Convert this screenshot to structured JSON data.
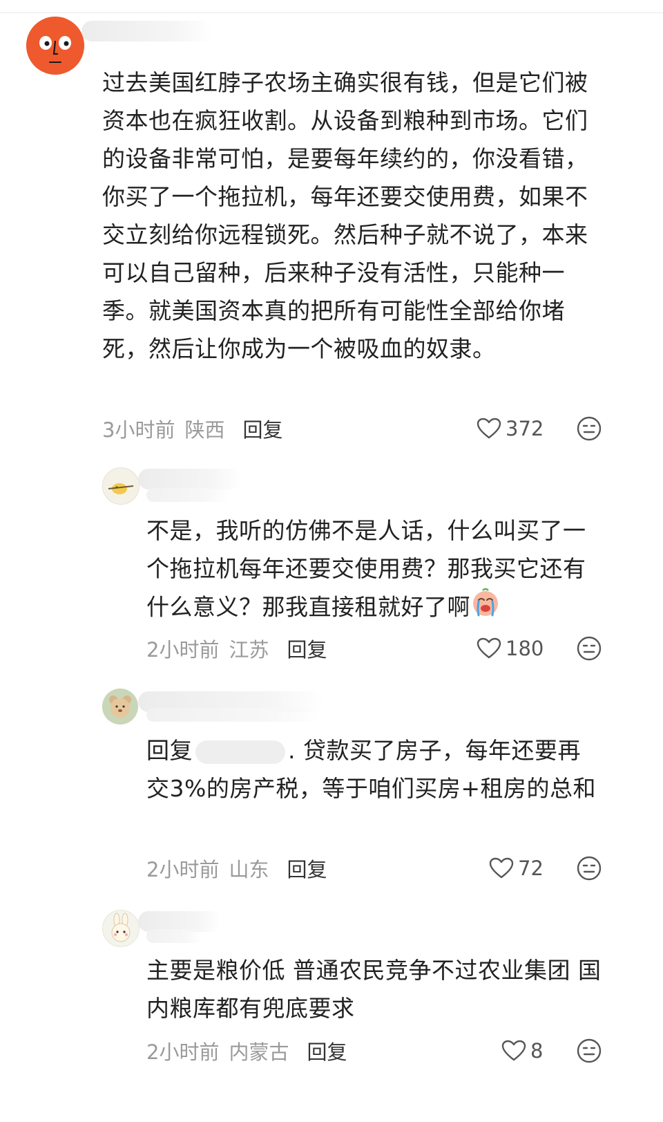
{
  "comments": [
    {
      "text": "过去美国红脖子农场主确实很有钱，但是它们被资本也在疯狂收割。从设备到粮种到市场。它们的设备非常可怕，是要每年续约的，你没看错，你买了一个拖拉机，每年还要交使用费，如果不交立刻给你远程锁死。然后种子就不说了，本来可以自己留种，后来种子没有活性，只能种一季。就美国资本真的把所有可能性全部给你堵死，然后让你成为一个被吸血的奴隶。",
      "time": "3小时前",
      "location": "陕西",
      "reply_label": "回复",
      "likes": "372"
    },
    {
      "text": "不是，我听的仿佛不是人话，什么叫买了一个拖拉机每年还要交使用费？那我买它还有什么意义？那我直接租就好了啊",
      "time": "2小时前",
      "location": "江苏",
      "reply_label": "回复",
      "likes": "180"
    },
    {
      "reply_prefix": "回复",
      "text_after_mention": ". 贷款买了房子，每年还要再交3%的房产税，等于咱们买房+租房的总和",
      "time": "2小时前",
      "location": "山东",
      "reply_label": "回复",
      "likes": "72"
    },
    {
      "text": "主要是粮价低 普通农民竞争不过农业集团 国内粮库都有兜底要求",
      "time": "2小时前",
      "location": "内蒙古",
      "reply_label": "回复",
      "likes": "8"
    }
  ]
}
